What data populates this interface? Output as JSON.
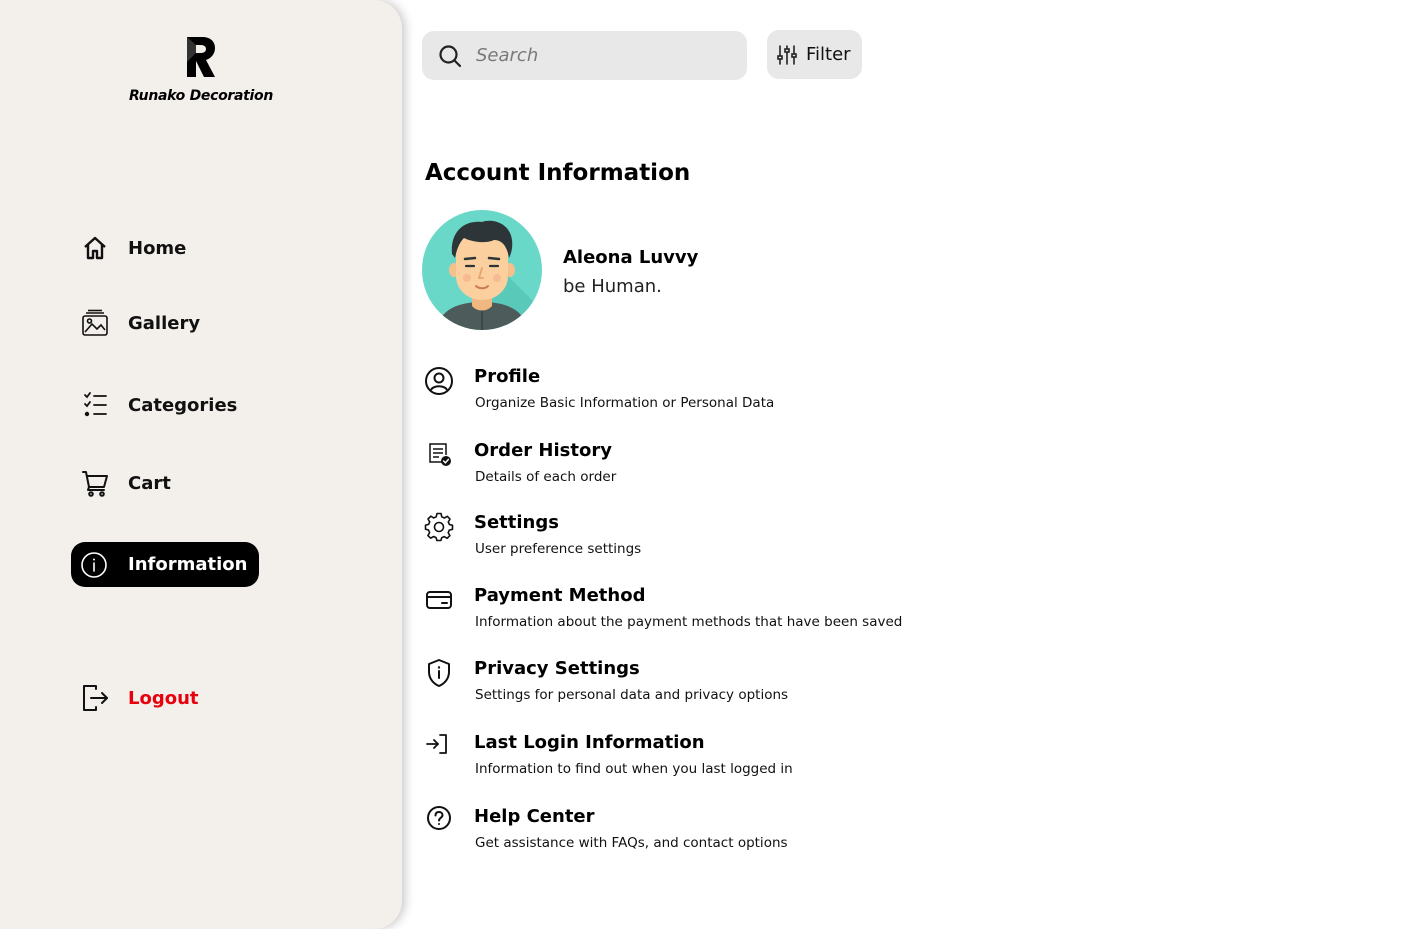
{
  "brand": {
    "name": "Runako Decoration",
    "logo_icon": "runako-r-logo"
  },
  "sidebar": {
    "items": [
      {
        "label": "Home",
        "icon": "home-icon"
      },
      {
        "label": "Gallery",
        "icon": "gallery-icon"
      },
      {
        "label": "Categories",
        "icon": "categories-list-icon"
      },
      {
        "label": "Cart",
        "icon": "cart-icon"
      },
      {
        "label": "Information",
        "icon": "info-icon",
        "active": true
      }
    ],
    "logout": {
      "label": "Logout",
      "icon": "logout-icon",
      "color": "#e8000d"
    }
  },
  "search": {
    "placeholder": "Search",
    "value": "",
    "icon": "search-icon"
  },
  "filter": {
    "label": "Filter",
    "icon": "sliders-icon"
  },
  "account": {
    "title": "Account Information",
    "user": {
      "name": "Aleona Luvvy",
      "tagline": "be Human.",
      "avatar_bg": "#6ad8c8"
    },
    "menu": [
      {
        "title": "Profile",
        "description": "Organize Basic Information or Personal Data",
        "icon": "user-circle-icon"
      },
      {
        "title": "Order History",
        "description": "Details of each order",
        "icon": "receipt-check-icon"
      },
      {
        "title": "Settings",
        "description": "User preference settings",
        "icon": "gear-icon"
      },
      {
        "title": "Payment Method",
        "description": "Information about the payment methods that have been saved",
        "icon": "credit-card-icon"
      },
      {
        "title": "Privacy Settings",
        "description": "Settings for personal data and privacy options",
        "icon": "shield-info-icon"
      },
      {
        "title": "Last Login Information",
        "description": "Information to find out when you last logged in",
        "icon": "login-arrow-icon"
      },
      {
        "title": "Help Center",
        "description": "Get assistance with FAQs, and contact options",
        "icon": "help-circle-icon"
      }
    ]
  },
  "colors": {
    "sidebar_bg": "#f3efeb",
    "active_bg": "#000000",
    "logout": "#e8000d",
    "input_bg": "#e8e8e8"
  }
}
